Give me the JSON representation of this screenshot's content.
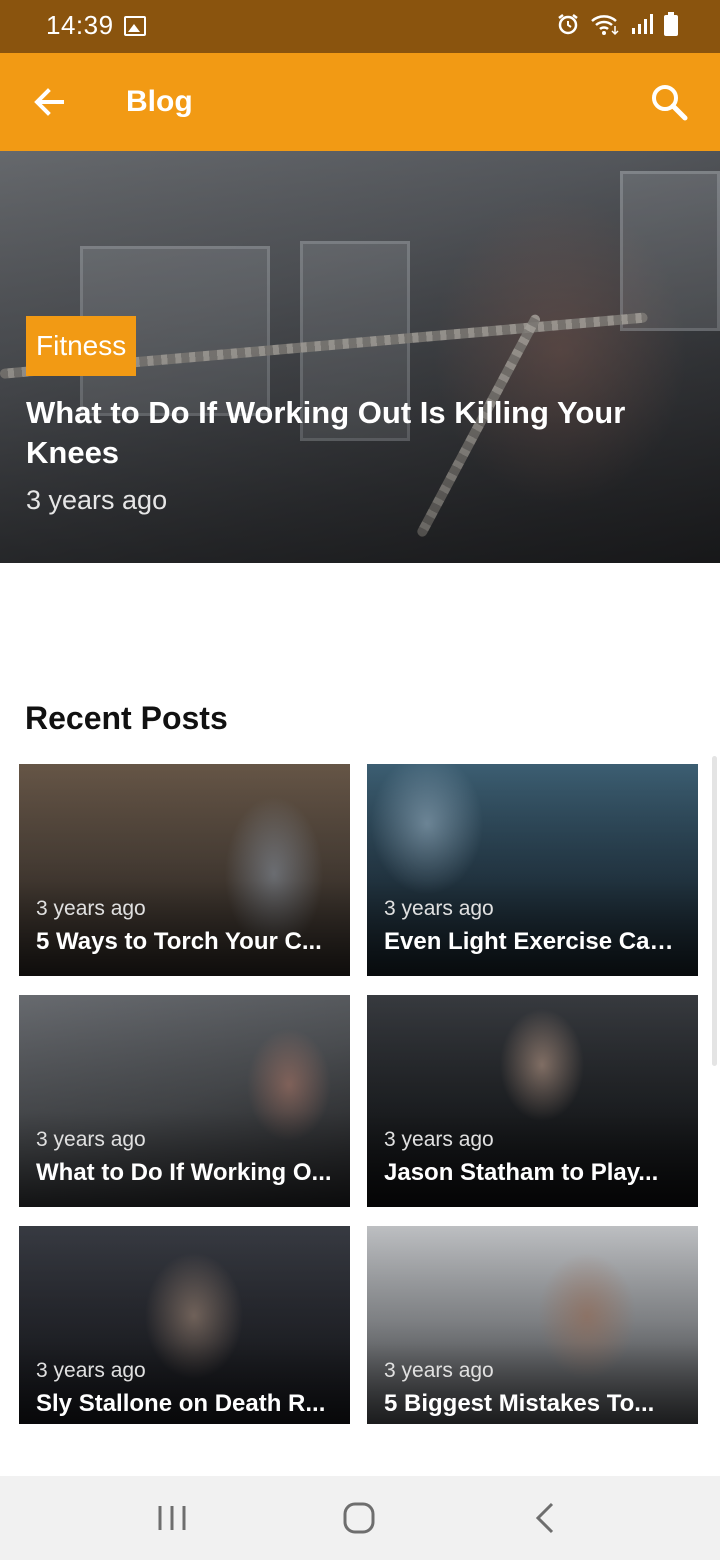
{
  "status_bar": {
    "time": "14:39"
  },
  "app_bar": {
    "title": "Blog"
  },
  "hero": {
    "category": "Fitness",
    "title": "What to Do If Working Out Is Killing Your Knees",
    "time": "3 years ago"
  },
  "recent": {
    "heading": "Recent Posts",
    "posts": [
      {
        "time": "3 years ago",
        "title": "5 Ways to Torch Your C..."
      },
      {
        "time": "3 years ago",
        "title": "Even Light Exercise Can..."
      },
      {
        "time": "3 years ago",
        "title": "What to Do If Working O..."
      },
      {
        "time": "3 years ago",
        "title": "Jason Statham to Play..."
      },
      {
        "time": "3 years ago",
        "title": "Sly Stallone on Death R..."
      },
      {
        "time": "3 years ago",
        "title": "5 Biggest Mistakes To..."
      }
    ]
  },
  "colors": {
    "accent": "#f29a14",
    "status_bar": "#8a540e"
  }
}
